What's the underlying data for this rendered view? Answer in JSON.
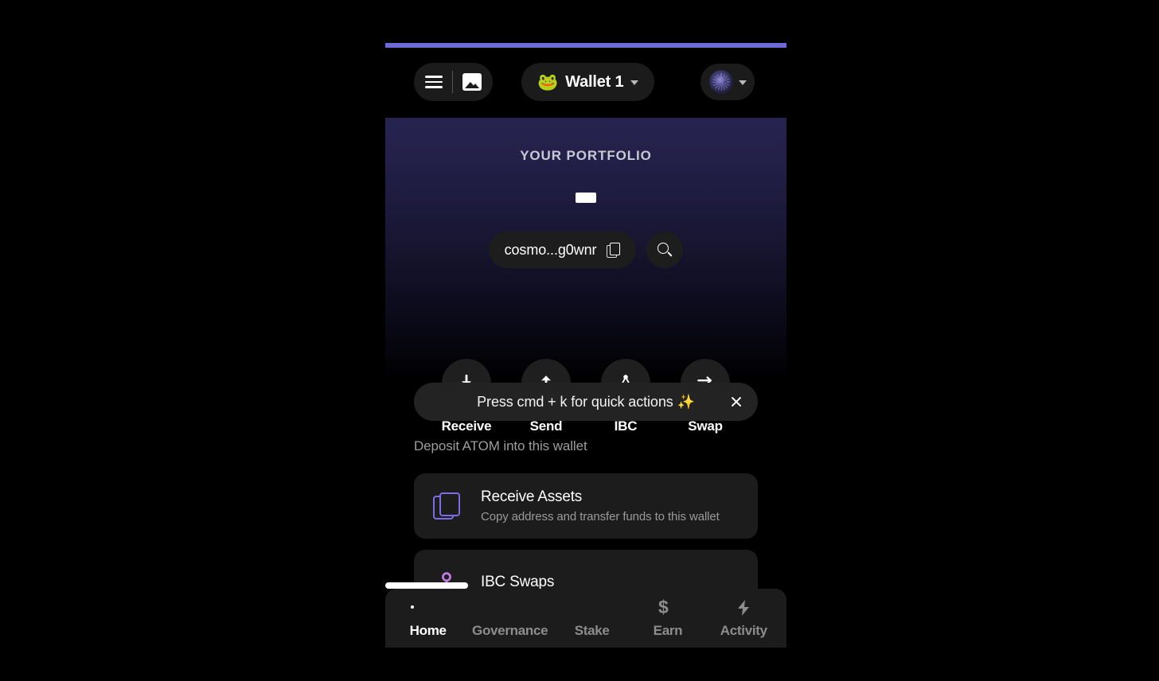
{
  "app": {
    "accent_color": "#6c6ad4",
    "background_color": "#000000"
  },
  "header": {
    "menu_icon": "hamburger-menu-icon",
    "gallery_icon": "image-icon",
    "wallet": {
      "emoji": "🐸",
      "name": "Wallet 1",
      "chevron_icon": "chevron-down-icon"
    },
    "network": {
      "avatar_icon": "network-avatar-icon",
      "chevron_icon": "chevron-down-icon"
    }
  },
  "portfolio": {
    "title": "YOUR PORTFOLIO",
    "balance_value": "",
    "balance_is_loading": true,
    "address": {
      "text": "cosmo...g0wnr",
      "copy_icon": "copy-icon"
    },
    "search_icon": "search-icon"
  },
  "quick_actions": [
    {
      "label": "Receive",
      "icon": "download-arrow-icon"
    },
    {
      "label": "Send",
      "icon": "upload-arrow-icon"
    },
    {
      "label": "IBC",
      "icon": "ibc-network-icon"
    },
    {
      "label": "Swap",
      "icon": "swap-arrows-icon"
    }
  ],
  "cmdk_banner": {
    "text": "Press cmd + k for quick actions ✨",
    "close_icon": "close-icon"
  },
  "deposit_section": {
    "label": "Deposit ATOM into this wallet",
    "items": [
      {
        "title": "Receive Assets",
        "subtitle": "Copy address and transfer funds to this wallet",
        "icon": "copy-duplicate-icon",
        "icon_color": "#7d6ce8"
      },
      {
        "title": "IBC Swaps",
        "subtitle": "",
        "icon": "ibc-swap-icon",
        "icon_color": "#c07de0"
      }
    ]
  },
  "bottom_nav": {
    "active": "Home",
    "items": [
      {
        "label": "Home",
        "icon": "wallet-icon",
        "active": true
      },
      {
        "label": "Governance",
        "icon": "bar-chart-icon",
        "active": false
      },
      {
        "label": "Stake",
        "icon": "trending-up-icon",
        "active": false
      },
      {
        "label": "Earn",
        "icon": "dollar-icon",
        "active": false
      },
      {
        "label": "Activity",
        "icon": "lightning-bolt-icon",
        "active": false
      }
    ]
  }
}
